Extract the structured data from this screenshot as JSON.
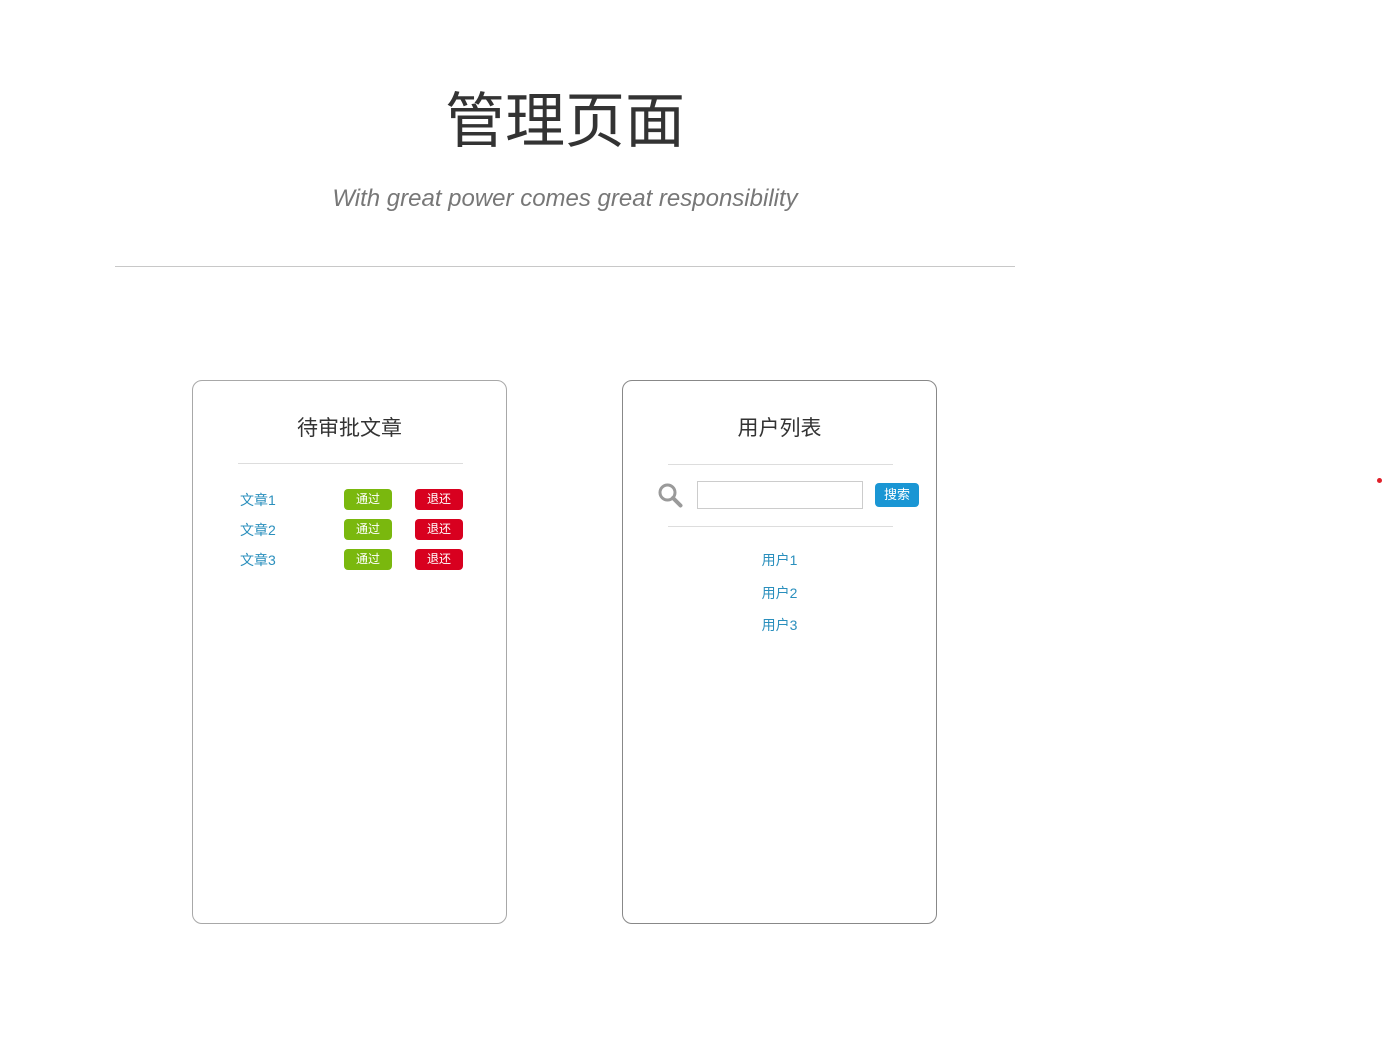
{
  "header": {
    "title": "管理页面",
    "subtitle": "With great power comes great responsibility"
  },
  "articles_card": {
    "title": "待审批文章",
    "approve_label": "通过",
    "reject_label": "退还",
    "items": [
      {
        "label": "文章1"
      },
      {
        "label": "文章2"
      },
      {
        "label": "文章3"
      }
    ]
  },
  "users_card": {
    "title": "用户列表",
    "search": {
      "value": "",
      "placeholder": "",
      "button_label": "搜索",
      "icon": "search-icon"
    },
    "items": [
      {
        "label": "用户1"
      },
      {
        "label": "用户2"
      },
      {
        "label": "用户3"
      }
    ]
  },
  "colors": {
    "approve": "#7ab80e",
    "reject": "#d8001f",
    "link": "#2a8fbd",
    "search_button": "#1a96d4"
  }
}
